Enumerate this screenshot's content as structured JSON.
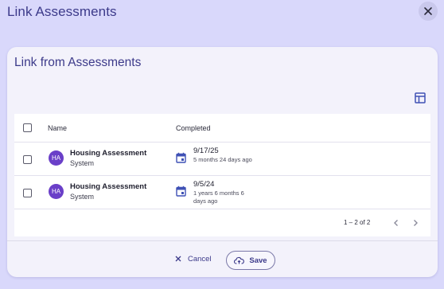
{
  "dialog": {
    "title": "Link Assessments"
  },
  "card": {
    "title": "Link from Assessments"
  },
  "table": {
    "columns": [
      "Name",
      "Completed"
    ],
    "rows": [
      {
        "initials": "HA",
        "name": "Housing Assessment",
        "source": "System",
        "date": "9/17/25",
        "ago": "5 months 24 days ago"
      },
      {
        "initials": "HA",
        "name": "Housing Assessment",
        "source": "System",
        "date": "9/5/24",
        "ago": "1 years 6 months 6 days ago"
      }
    ]
  },
  "pagination": {
    "range": "1 – 2 of 2"
  },
  "footer": {
    "cancel_label": "Cancel",
    "save_label": "Save"
  },
  "colors": {
    "background": "#d9d8fb",
    "accent": "#3c3a8a",
    "avatar": "#6a3fc8",
    "calendar_icon": "#3f51b5"
  },
  "icons": [
    "close-icon",
    "table-layout-icon",
    "calendar-icon",
    "chevron-left-icon",
    "chevron-right-icon",
    "x-icon",
    "cloud-upload-icon"
  ]
}
